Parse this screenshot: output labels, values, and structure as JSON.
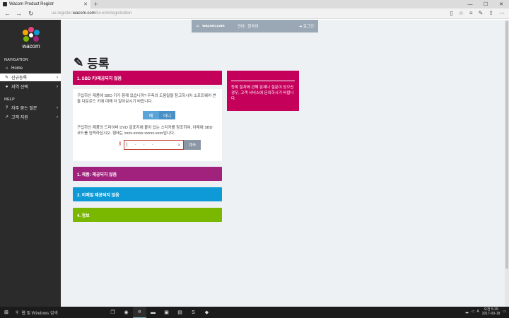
{
  "browser": {
    "tab_title": "Wacom Product Registr",
    "url_prefix": "us-register.",
    "url_domain": "wacom.com",
    "url_path": "/ko-kr/#/registration"
  },
  "sidebar": {
    "logo_text": "wacom",
    "nav_heading": "NAVIGATION",
    "help_heading": "HELP",
    "items": [
      {
        "label": "Home"
      },
      {
        "label": "신규등록"
      },
      {
        "label": "지역 선택"
      }
    ],
    "help_items": [
      {
        "label": "자주 묻는 질문"
      },
      {
        "label": "고객 지원"
      }
    ]
  },
  "topbar": {
    "brand": "wacom.com",
    "lang_label": "언어:",
    "lang_value": "한국어",
    "login": "로그인"
  },
  "page": {
    "title": "등록",
    "step1_title": "1. SBD 키/제공되지 않음",
    "panel_text1": "구입하신 제품에 SBD 키가 함께 있습니까? 우측의 도움말을 참고하시어 소프트웨어 번들 다운로드 키에 대해 더 알아보시기 바랍니다.",
    "yes": "예",
    "no": "아니",
    "panel_text2": "구입하신 제품의 드라이버 DVD 겉표지에 붙어 있는 스티커를 참조하여, 아래에 SBD 코드를 입력하십시오. 형태는 xxxx-xxxxx-xxxxx-xxxx입니다.",
    "sbd_seg": "-",
    "continue": "계속",
    "step2_title": "1. 제품: 제공되지 않음",
    "step3_title": "3. 이메일 제공되지 않음",
    "step4_title": "4. 정보",
    "help_text": "등록 절차에 관해 문제나 질문이 있으신 경우, 고객 서비스에 문의하시기 바랍니다."
  },
  "colors": {
    "step1": "#c4005b",
    "step2": "#a0227d",
    "step3": "#0e9ad7",
    "step4": "#7ab800"
  },
  "taskbar": {
    "search": "웹 및 Windows 검색",
    "time": "오전 5:29",
    "date": "2017-09-18"
  }
}
